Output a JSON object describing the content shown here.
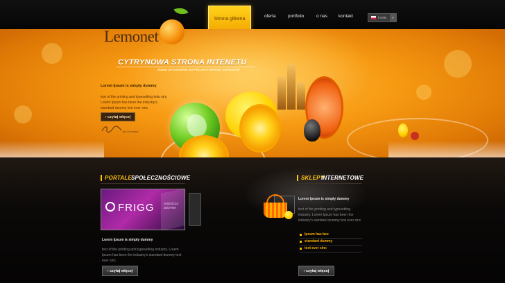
{
  "nav": {
    "items": [
      {
        "label": "Strona główna",
        "active": true
      },
      {
        "label": "oferta"
      },
      {
        "label": "portfolio"
      },
      {
        "label": "o nas"
      },
      {
        "label": "kontakt"
      }
    ],
    "language": "Polski"
  },
  "logo": {
    "text": "Lemonet"
  },
  "hero": {
    "title": "CYTRYNOWA STRONA INTENETU",
    "subtitle": "NOWE SPOJRZENIE NA PROJEKTOWANIE SERWISÓW",
    "heading": "Lorem Ipsum is simply dummy",
    "text": "text of the printing and typesetting indu stry. Lorem Ipsum has been the industry's standard dummy text ever sinc",
    "button": "› czytaj więcej",
    "signature_name": "Jan Kowalski"
  },
  "social": {
    "title_white": "PORTALE",
    "title_yellow": "SPOŁECZNOŚCIOWE",
    "heading": "Lorem Ipsum is simply dummy",
    "text": "text of the printing and typesetting industry. Lorem Ipsum has been the industry's standard dummy text ever sinc",
    "button": "› czytaj więcej",
    "image_brand": "FRIGG",
    "image_tagline": "AGENCJA JEDYNA"
  },
  "shops": {
    "title_yellow": "SKLEPY",
    "title_white": "INTERNETOWE",
    "heading": "Lorem Ipsum is simply dummy",
    "text": "text of the printing and typesetting industry. Lorem Ipsum has been the industry's standard dummy text ever sinc",
    "list": [
      "Ipsum has bee",
      "standard dummy",
      "text ever sinc"
    ],
    "button": "› czytaj więcej"
  },
  "colors": {
    "accent": "#ffc20a",
    "hero_orange": "#f79a12",
    "background": "#070605"
  }
}
